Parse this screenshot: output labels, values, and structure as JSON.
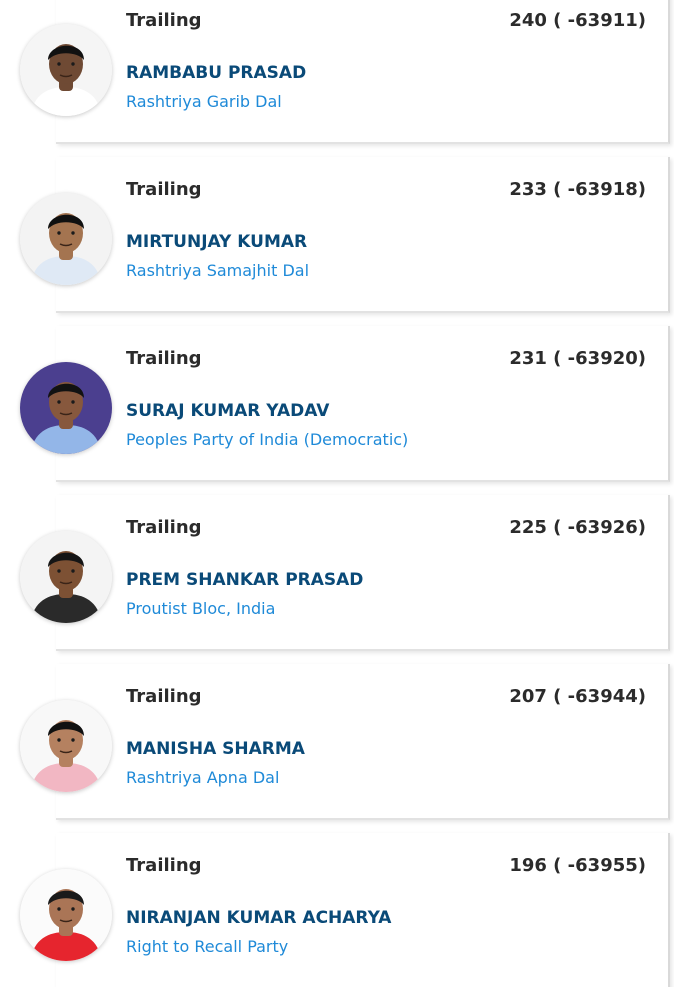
{
  "candidates": [
    {
      "status": "Trailing",
      "votes": "240 ( -63911)",
      "name": "RAMBABU PRASAD",
      "party": "Rashtriya Garib Dal",
      "photo": "candidate-photo",
      "shirt": "#ffffff",
      "skin": "#6f4a34",
      "hair": "#111111",
      "bg": "#f5f5f5"
    },
    {
      "status": "Trailing",
      "votes": "233 ( -63918)",
      "name": "MIRTUNJAY KUMAR",
      "party": "Rashtriya Samajhit Dal",
      "photo": "candidate-photo",
      "shirt": "#dfe9f5",
      "skin": "#a47450",
      "hair": "#101010",
      "bg": "#f3f3f3"
    },
    {
      "status": "Trailing",
      "votes": "231 ( -63920)",
      "name": "SURAJ KUMAR YADAV",
      "party": "Peoples Party of India (Democratic)",
      "photo": "candidate-photo",
      "shirt": "#93b6e8",
      "skin": "#87583d",
      "hair": "#121212",
      "bg": "#4b3f8f"
    },
    {
      "status": "Trailing",
      "votes": "225 ( -63926)",
      "name": "PREM SHANKAR PRASAD",
      "party": "Proutist Bloc, India",
      "photo": "candidate-photo",
      "shirt": "#2a2a2a",
      "skin": "#7d5134",
      "hair": "#151515",
      "bg": "#f4f4f4"
    },
    {
      "status": "Trailing",
      "votes": "207 ( -63944)",
      "name": "MANISHA SHARMA",
      "party": "Rashtriya Apna Dal",
      "photo": "candidate-photo",
      "shirt": "#f2b7c3",
      "skin": "#b58160",
      "hair": "#111111",
      "bg": "#f8f8f8"
    },
    {
      "status": "Trailing",
      "votes": "196 ( -63955)",
      "name": "NIRANJAN KUMAR ACHARYA",
      "party": "Right to Recall Party",
      "photo": "candidate-photo",
      "shirt": "#e6252e",
      "skin": "#aa7556",
      "hair": "#1a1a1a",
      "bg": "#fbfbfb"
    }
  ]
}
